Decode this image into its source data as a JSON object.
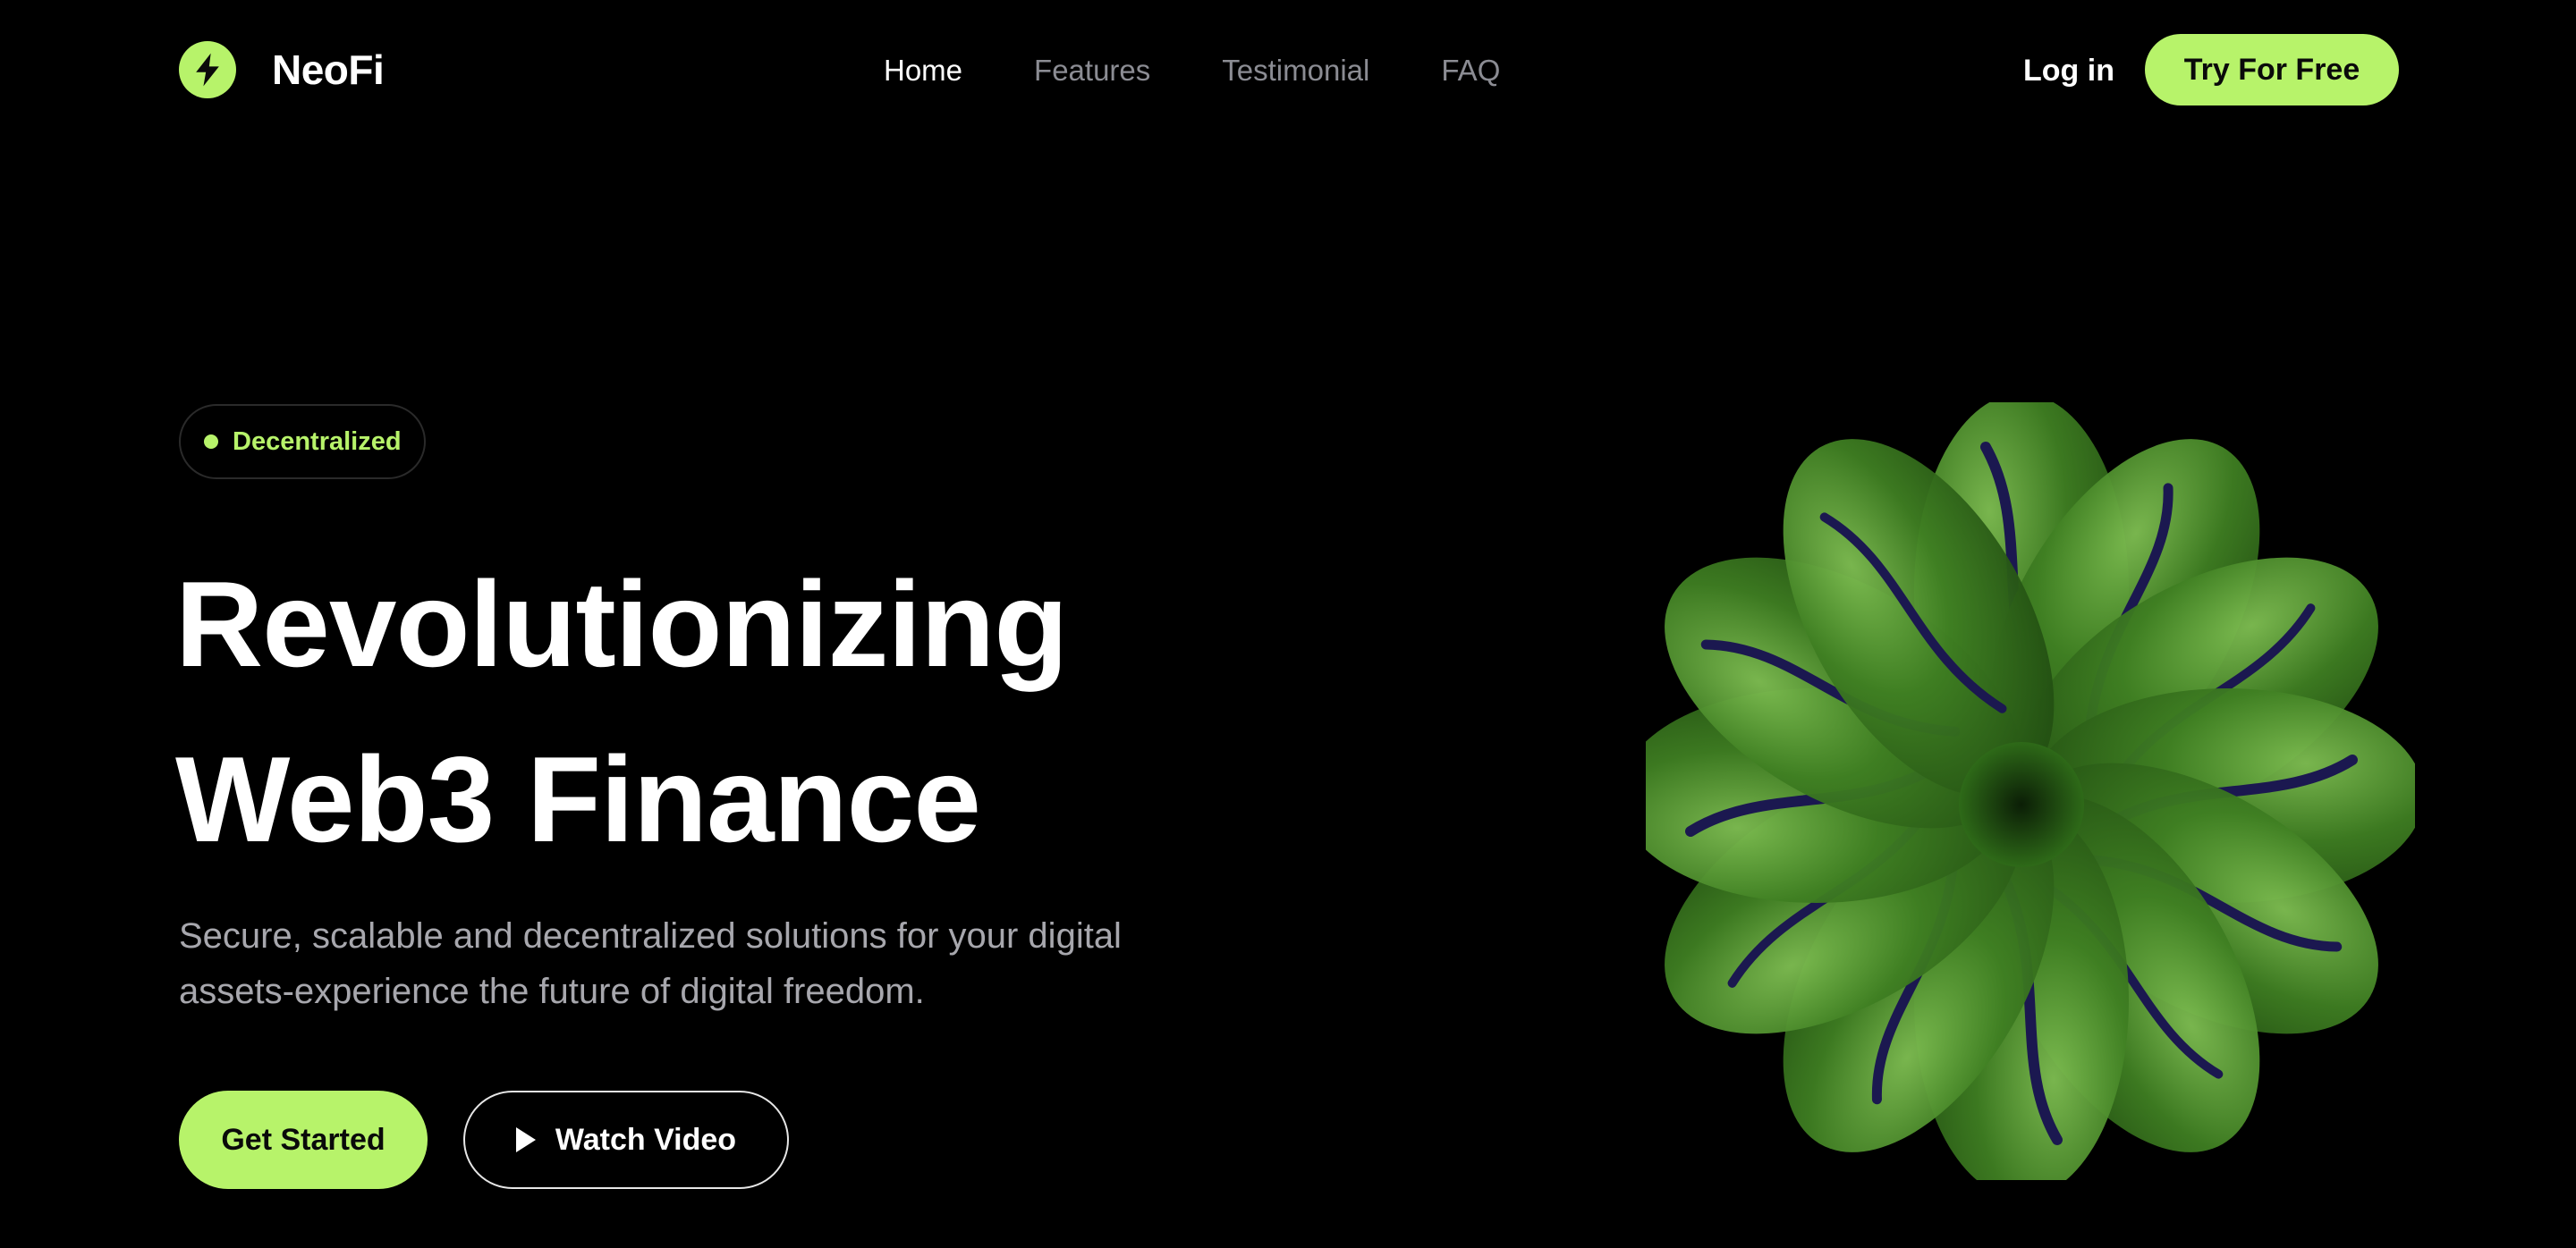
{
  "brand": {
    "name": "NeoFi",
    "accent": "#b7f36a"
  },
  "nav": {
    "links": [
      {
        "label": "Home"
      },
      {
        "label": "Features"
      },
      {
        "label": "Testimonial"
      },
      {
        "label": "FAQ"
      }
    ],
    "login_label": "Log in",
    "cta_label": "Try For Free"
  },
  "hero": {
    "badge": "Decentralized",
    "title_line1": "Revolutionizing",
    "title_line2": "Web3 Finance",
    "subtitle": "Secure, scalable and decentralized solutions for your digital assets-experience the future of digital freedom.",
    "primary_button": "Get Started",
    "secondary_button": "Watch Video"
  },
  "icons": {
    "logo": "lightning-bolt-icon",
    "play": "play-icon"
  }
}
